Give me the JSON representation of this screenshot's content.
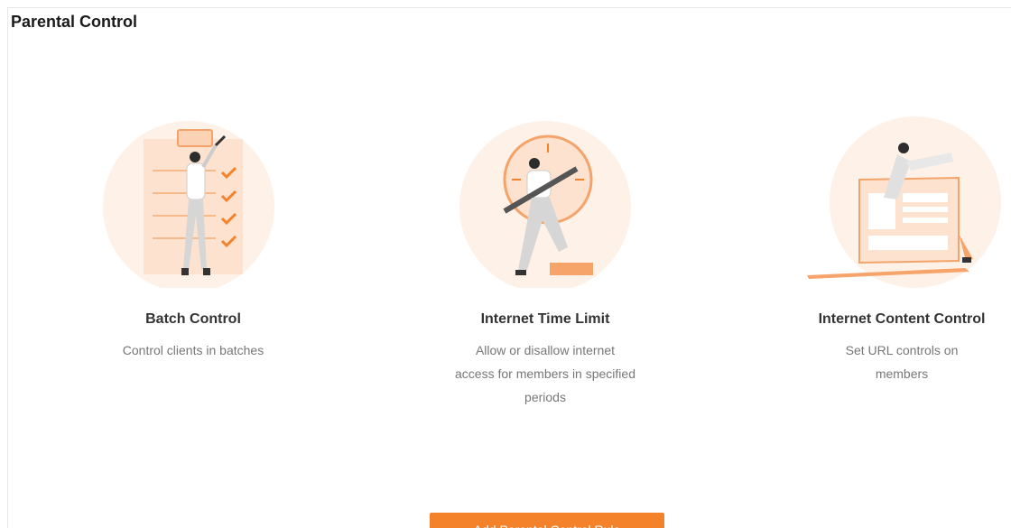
{
  "page": {
    "title": "Parental Control"
  },
  "features": [
    {
      "icon": "batch-control-illustration",
      "title": "Batch Control",
      "description": "Control clients in batches"
    },
    {
      "icon": "internet-time-limit-illustration",
      "title": "Internet Time Limit",
      "description": "Allow or disallow internet access for members in specified periods"
    },
    {
      "icon": "internet-content-control-illustration",
      "title": "Internet Content Control",
      "description": "Set URL controls on members"
    }
  ],
  "actions": {
    "add_rule_label": "Add Parental Control Rule"
  },
  "colors": {
    "accent": "#f4822a",
    "accent_light": "#fde9da",
    "title_text": "#333333",
    "desc_text": "#777777"
  }
}
